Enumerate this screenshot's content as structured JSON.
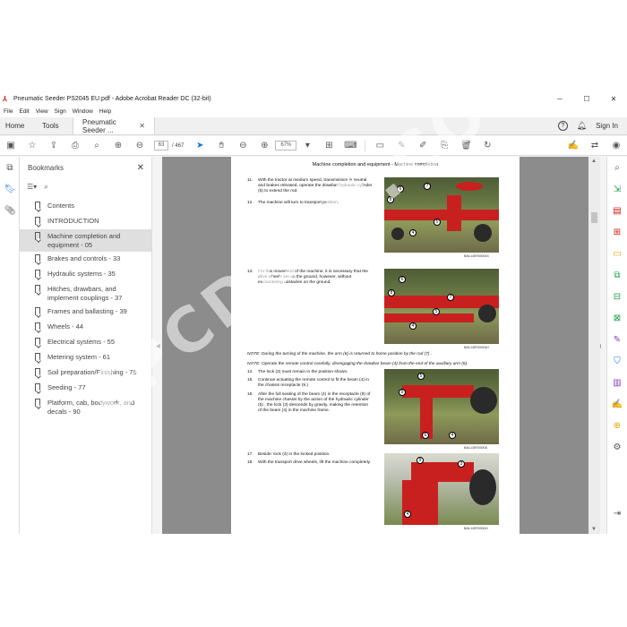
{
  "window": {
    "title": "Pneumatic Seeder PS2045 EU.pdf - Adobe Acrobat Reader DC (32-bit)",
    "controls": [
      "─",
      "☐",
      "✕"
    ]
  },
  "menu": [
    "File",
    "Edit",
    "View",
    "Sign",
    "Window",
    "Help"
  ],
  "tabs": {
    "home": "Home",
    "tools": "Tools",
    "document": "Pneumatic Seeder ...",
    "signin": "Sign In"
  },
  "toolbar": {
    "current_page": "63",
    "page_sep": "/",
    "total_pages": "467",
    "zoom": "67%"
  },
  "bookmarks": {
    "title": "Bookmarks",
    "items": [
      "Contents",
      "INTRODUCTION",
      "Machine completion and equipment - 05",
      "Brakes and controls - 33",
      "Hydraulic systems - 35",
      "Hitches, drawbars, and implement couplings - 37",
      "Frames and ballasting - 39",
      "Wheels - 44",
      "Electrical systems - 55",
      "Metering system - 61",
      "Soil preparation/Finishing - 75",
      "Seeding - 77",
      "Platform, cab, bodywork, and decals - 90"
    ],
    "selected_index": 2
  },
  "page": {
    "header": "Machine completion and equipment - Machine completion",
    "steps": [
      {
        "num": "11.",
        "text": "With the tractor at medium speed, transmission in neutral and brakes released, operate the drawbar hydraulic cylinder (5) to extend the rod."
      },
      {
        "num": "12.",
        "text": "The machine will turn to transport position."
      },
      {
        "num": "13.",
        "text": "For this movement of the machine, it is necessary that the drive wheels are on the ground, however, without encountering obstacles on the ground."
      },
      {
        "num": "14.",
        "text": "The lock (3) must remain in the position shown."
      },
      {
        "num": "15.",
        "text": "Continue actuating the remote control to fit the beam (4) in the chassis receptacle (9.)"
      },
      {
        "num": "16.",
        "text": "After the full seating of the beam (4) in the receptacle (9) of the machine chassis by the action of the hydraulic cylinder (5) , the lock (3) descends by gravity, making the retention of the beam (4) in the machine frame."
      },
      {
        "num": "17.",
        "text": "Beside: lock (3) in the locked position."
      },
      {
        "num": "18.",
        "text": "With the transport drive wheels, lift the machine completely."
      }
    ],
    "notes": [
      "NOTE: During the turning of the machine, the arm (6) is returned to home position by the rod (7) .",
      "NOTE: Operate the remote control carefully, disengaging the drawbar beam (4) from the end of the auxiliary arm (6)."
    ],
    "captions": [
      "BAIL14ER00004G",
      "BAIL14ER00004H",
      "BAIL14ER00004I",
      "BAIL14ER00004J"
    ],
    "callouts": {
      "photo1": [
        "6",
        "7",
        "8",
        "4",
        "5"
      ],
      "photo2": [
        "6",
        "8",
        "4",
        "5",
        "7"
      ],
      "photo3": [
        "5",
        "9",
        "4",
        "6"
      ],
      "photo4": [
        "9",
        "3",
        "4"
      ]
    }
  },
  "watermark": "EPCDEPO.COM",
  "colors": {
    "accent": "#1473e6",
    "acrobat_red": "#d4150a",
    "machine_red": "#c8201e"
  }
}
